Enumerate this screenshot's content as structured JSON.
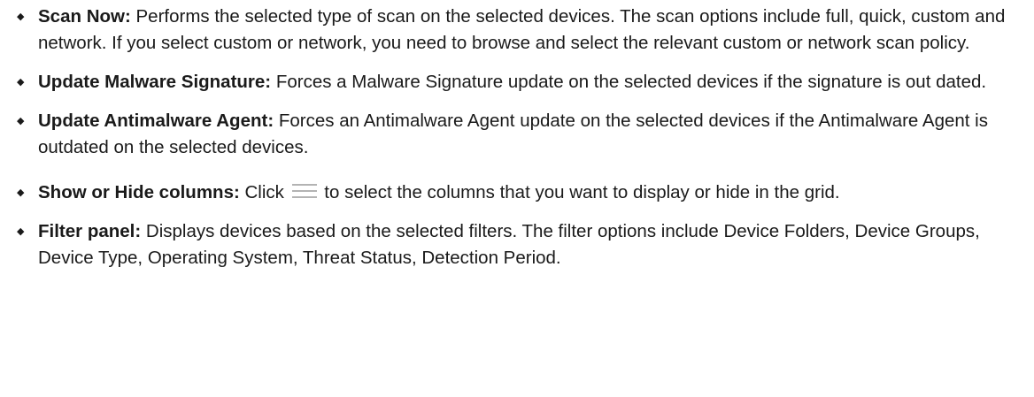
{
  "items": [
    {
      "bullet_icon": "diamond-bullet",
      "term": "Scan Now:",
      "text": " Performs the selected type of scan on the selected devices. The scan options include full, quick, custom and network. If you select custom or network, you need to browse and select the relevant custom or network scan policy."
    },
    {
      "bullet_icon": "diamond-bullet",
      "term": "Update Malware Signature:",
      "text": " Forces a Malware Signature update on the selected devices if the signature is out dated."
    },
    {
      "bullet_icon": "diamond-bullet",
      "term": "Update Antimalware Agent:",
      "text": " Forces an Antimalware Agent update on the selected devices if the Antimalware Agent is outdated on the selected devices."
    },
    {
      "bullet_icon": "diamond-bullet",
      "term": "Show or Hide columns:",
      "text_before_icon": " Click ",
      "inline_icon": "hamburger-menu-icon",
      "text_after_icon": " to select the columns that you want to display or hide in the grid."
    },
    {
      "bullet_icon": "diamond-bullet",
      "term": "Filter panel:",
      "text": " Displays devices based on the selected filters. The filter options include Device Folders, Device Groups, Device Type, Operating System, Threat Status, Detection Period."
    }
  ]
}
